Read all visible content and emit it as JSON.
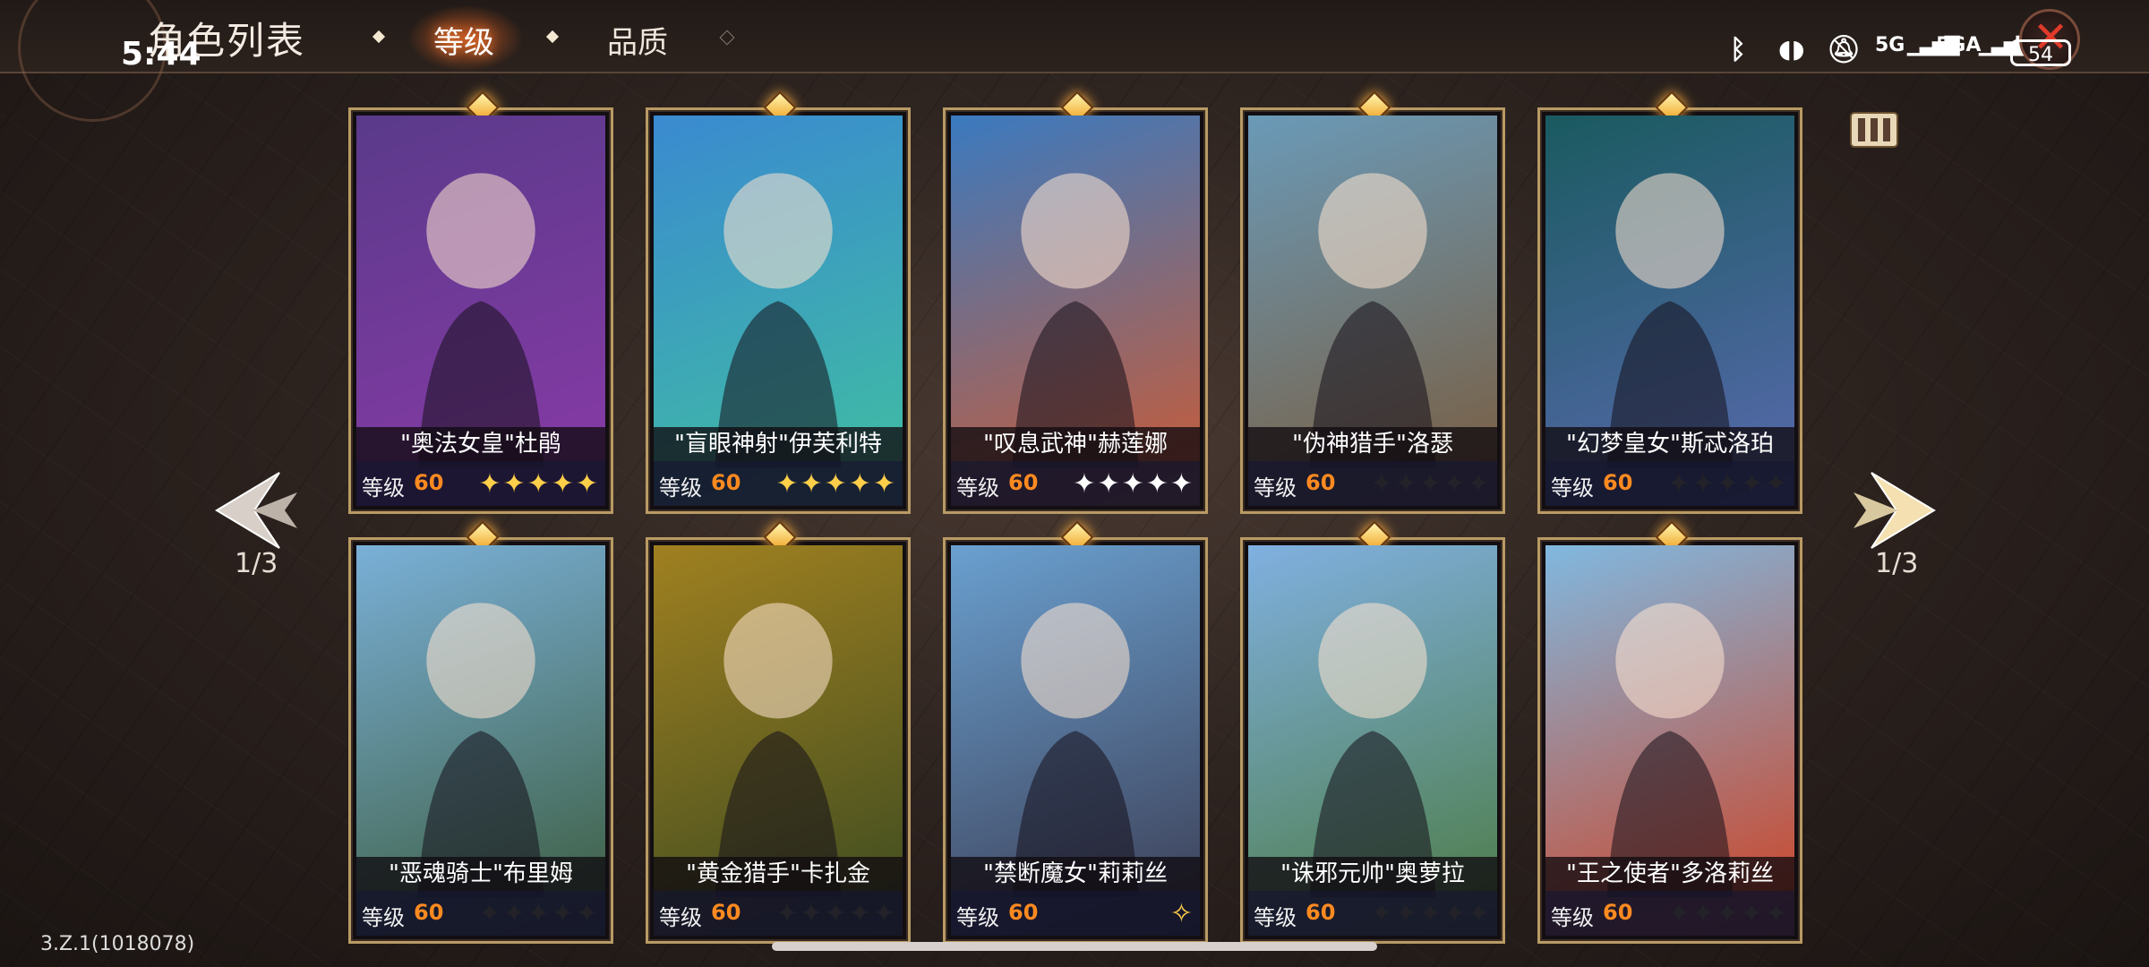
{
  "header": {
    "title": "角色列表",
    "time": "5:44",
    "tabs": [
      {
        "label": "等级",
        "active": true
      },
      {
        "label": "品质",
        "active": false
      }
    ]
  },
  "status": {
    "net1": "5G",
    "net2": "5GA",
    "battery": "54"
  },
  "pager": {
    "left": "1/3",
    "right": "1/3"
  },
  "version": "3.Z.1(1018078)",
  "level_label": "等级",
  "cards": [
    {
      "name": "\"奥法女皇\"杜鹃",
      "level": "60",
      "stars": "✦✦✦✦✦",
      "star_color": "#ffcf4a",
      "bg": "#5a3a8a,#8a3aa8"
    },
    {
      "name": "\"盲眼神射\"伊芙利特",
      "level": "60",
      "stars": "✦✦✦✦✦",
      "star_color": "#ffcf4a",
      "bg": "#3a8ad0,#40c0a0"
    },
    {
      "name": "\"叹息武神\"赫莲娜",
      "level": "60",
      "stars": "✦✦✦✦✦",
      "star_color": "#ffffff",
      "bg": "#3a7ac0,#d05a30"
    },
    {
      "name": "\"伪神猎手\"洛瑟",
      "level": "60",
      "stars": "✦✦✦✦✦",
      "star_color": "#222228",
      "bg": "#6a9ab8,#7a5a3a"
    },
    {
      "name": "\"幻梦皇女\"斯忒洛珀",
      "level": "60",
      "stars": "✦✦✦✦✦",
      "star_color": "#222228",
      "bg": "#1a5a60,#5a6ab0"
    },
    {
      "name": "\"恶魂骑士\"布里姆",
      "level": "60",
      "stars": "✦✦✦✦✦",
      "star_color": "#222228",
      "bg": "#7ab0d8,#3a5a3a"
    },
    {
      "name": "\"黄金猎手\"卡扎金",
      "level": "60",
      "stars": "✦✦✦✦✦",
      "star_color": "#222228",
      "bg": "#a08020,#3a4a20"
    },
    {
      "name": "\"禁断魔女\"莉莉丝",
      "level": "60",
      "stars": "✧",
      "star_color": "#ffcf4a",
      "bg": "#6aa0d0,#3a3a50"
    },
    {
      "name": "\"诛邪元帅\"奥萝拉",
      "level": "60",
      "stars": "✦✦✦✦✦",
      "star_color": "#222228",
      "bg": "#80b0e0,#4a7a40"
    },
    {
      "name": "\"王之使者\"多洛莉丝",
      "level": "60",
      "stars": "✦✦✦✦✦",
      "star_color": "#222228",
      "bg": "#80b8e0,#d04020"
    }
  ]
}
